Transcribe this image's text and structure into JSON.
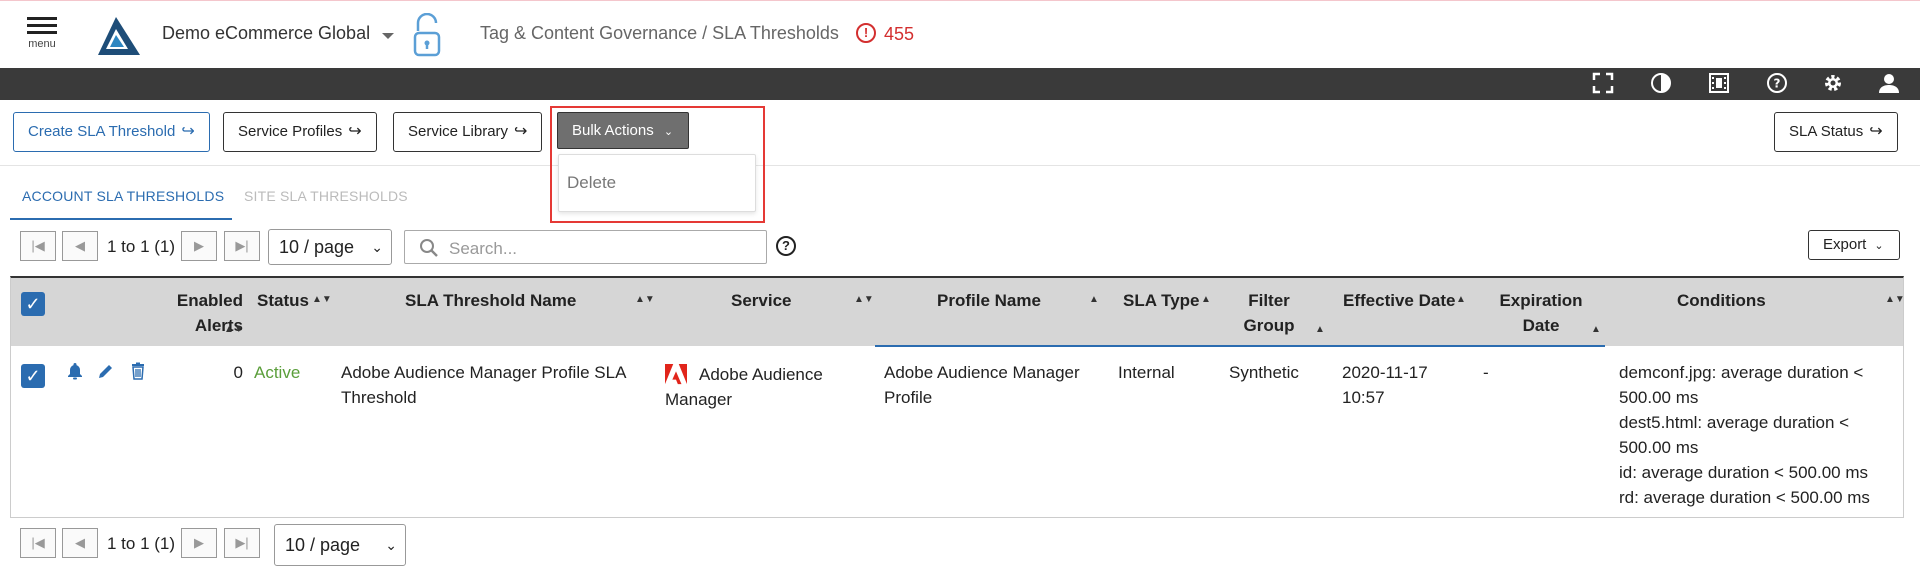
{
  "header": {
    "menu_label": "menu",
    "org_name": "Demo eCommerce Global",
    "breadcrumb": "Tag & Content Governance / SLA Thresholds",
    "alert_count": "455"
  },
  "toolbar": {
    "create_label": "Create SLA Threshold",
    "service_profiles_label": "Service Profiles",
    "service_library_label": "Service Library",
    "bulk_actions_label": "Bulk Actions",
    "bulk_menu_items": [
      "Delete"
    ],
    "sla_status_label": "SLA Status"
  },
  "tabs": [
    "ACCOUNT SLA THRESHOLDS",
    "SITE SLA THRESHOLDS"
  ],
  "pager": {
    "range_text": "1 to 1 (1)",
    "page_size": "10 / page",
    "search_placeholder": "Search..."
  },
  "export_label": "Export",
  "table": {
    "headers": {
      "enabled_alerts": "Enabled Alerts",
      "status": "Status",
      "name": "SLA Threshold Name",
      "service": "Service",
      "profile": "Profile Name",
      "sla_type": "SLA Type",
      "filter_group": "Filter Group",
      "effective_date": "Effective Date",
      "expiration_date": "Expiration Date",
      "conditions": "Conditions"
    },
    "rows": [
      {
        "enabled_alerts": "0",
        "status": "Active",
        "name": "Adobe Audience Manager Profile SLA Threshold",
        "service": "Adobe Audience Manager",
        "profile": "Adobe Audience Manager Profile",
        "sla_type": "Internal",
        "filter_group": "Synthetic",
        "effective_date": "2020-11-17 10:57",
        "expiration_date": "-",
        "conditions": [
          "demconf.jpg: average duration < 500.00 ms",
          "dest5.html: average duration < 500.00 ms",
          "id: average duration < 500.00 ms",
          "rd: average duration < 500.00 ms"
        ]
      }
    ]
  },
  "colors": {
    "accent": "#2b6cb0",
    "alert": "#d32f2f",
    "active_status": "#5a9e3a",
    "dark_bar": "#3a3a3a",
    "highlight": "#e53935"
  },
  "icons": [
    "menu-icon",
    "logo-icon",
    "lock-icon",
    "alert-icon",
    "fullscreen-icon",
    "contrast-icon",
    "film-icon",
    "help-icon",
    "gear-icon",
    "user-icon",
    "share-arrow-icon",
    "chevron-down-icon",
    "search-icon",
    "bell-icon",
    "pencil-icon",
    "trash-icon",
    "adobe-icon",
    "sort-icon",
    "first-page-icon",
    "prev-page-icon",
    "next-page-icon",
    "last-page-icon",
    "checkbox-icon"
  ]
}
